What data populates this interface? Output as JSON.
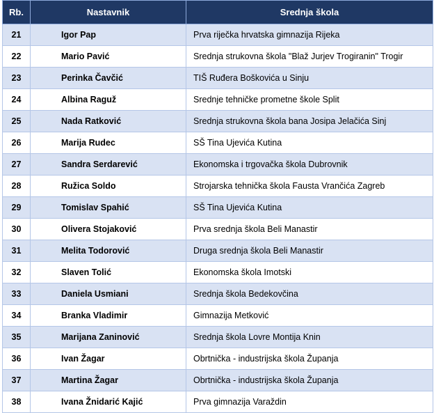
{
  "table": {
    "headers": {
      "rb": "Rb.",
      "nastavnik": "Nastavnik",
      "srednja_skola": "Srednja škola"
    },
    "rows": [
      {
        "rb": "21",
        "nastavnik": "Igor Pap",
        "skola": "Prva riječka hrvatska gimnazija Rijeka"
      },
      {
        "rb": "22",
        "nastavnik": "Mario Pavić",
        "skola": "Srednja strukovna škola \"Blaž Jurjev Trogiranin\" Trogir"
      },
      {
        "rb": "23",
        "nastavnik": "Perinka Čavčić",
        "skola": "TIŠ Ruđera Boškovića u Sinju"
      },
      {
        "rb": "24",
        "nastavnik": "Albina Raguž",
        "skola": "Srednje tehničke prometne škole Split"
      },
      {
        "rb": "25",
        "nastavnik": "Nada Ratković",
        "skola": "Srednja strukovna škola bana Josipa Jelačića Sinj"
      },
      {
        "rb": "26",
        "nastavnik": "Marija Rudec",
        "skola": "SŠ Tina Ujevića Kutina"
      },
      {
        "rb": "27",
        "nastavnik": "Sandra Serdarević",
        "skola": "Ekonomska i trgovačka škola Dubrovnik"
      },
      {
        "rb": "28",
        "nastavnik": "Ružica Soldo",
        "skola": "Strojarska tehnička škola Fausta Vrančića Zagreb"
      },
      {
        "rb": "29",
        "nastavnik": "Tomislav Spahić",
        "skola": "SŠ Tina Ujevića Kutina"
      },
      {
        "rb": "30",
        "nastavnik": "Olivera Stojaković",
        "skola": "Prva srednja škola Beli Manastir"
      },
      {
        "rb": "31",
        "nastavnik": "Melita Todorović",
        "skola": "Druga srednja škola Beli Manastir"
      },
      {
        "rb": "32",
        "nastavnik": "Slaven Tolić",
        "skola": "Ekonomska škola Imotski"
      },
      {
        "rb": "33",
        "nastavnik": "Daniela Usmiani",
        "skola": "Srednja škola Bedekovčina"
      },
      {
        "rb": "34",
        "nastavnik": "Branka Vladimir",
        "skola": "Gimnazija Metković"
      },
      {
        "rb": "35",
        "nastavnik": "Marijana Zaninović",
        "skola": "Srednja škola Lovre Montija Knin"
      },
      {
        "rb": "36",
        "nastavnik": "Ivan Žagar",
        "skola": "Obrtnička - industrijska škola Županja"
      },
      {
        "rb": "37",
        "nastavnik": "Martina Žagar",
        "skola": "Obrtnička - industrijska škola Županja"
      },
      {
        "rb": "38",
        "nastavnik": "Ivana Žnidarić Kajić",
        "skola": "Prva gimnazija Varaždin"
      }
    ]
  },
  "colors": {
    "header_bg": "#1f3864",
    "header_text": "#ffffff",
    "band_row": "#d9e2f3",
    "border": "#b4c6e7"
  }
}
